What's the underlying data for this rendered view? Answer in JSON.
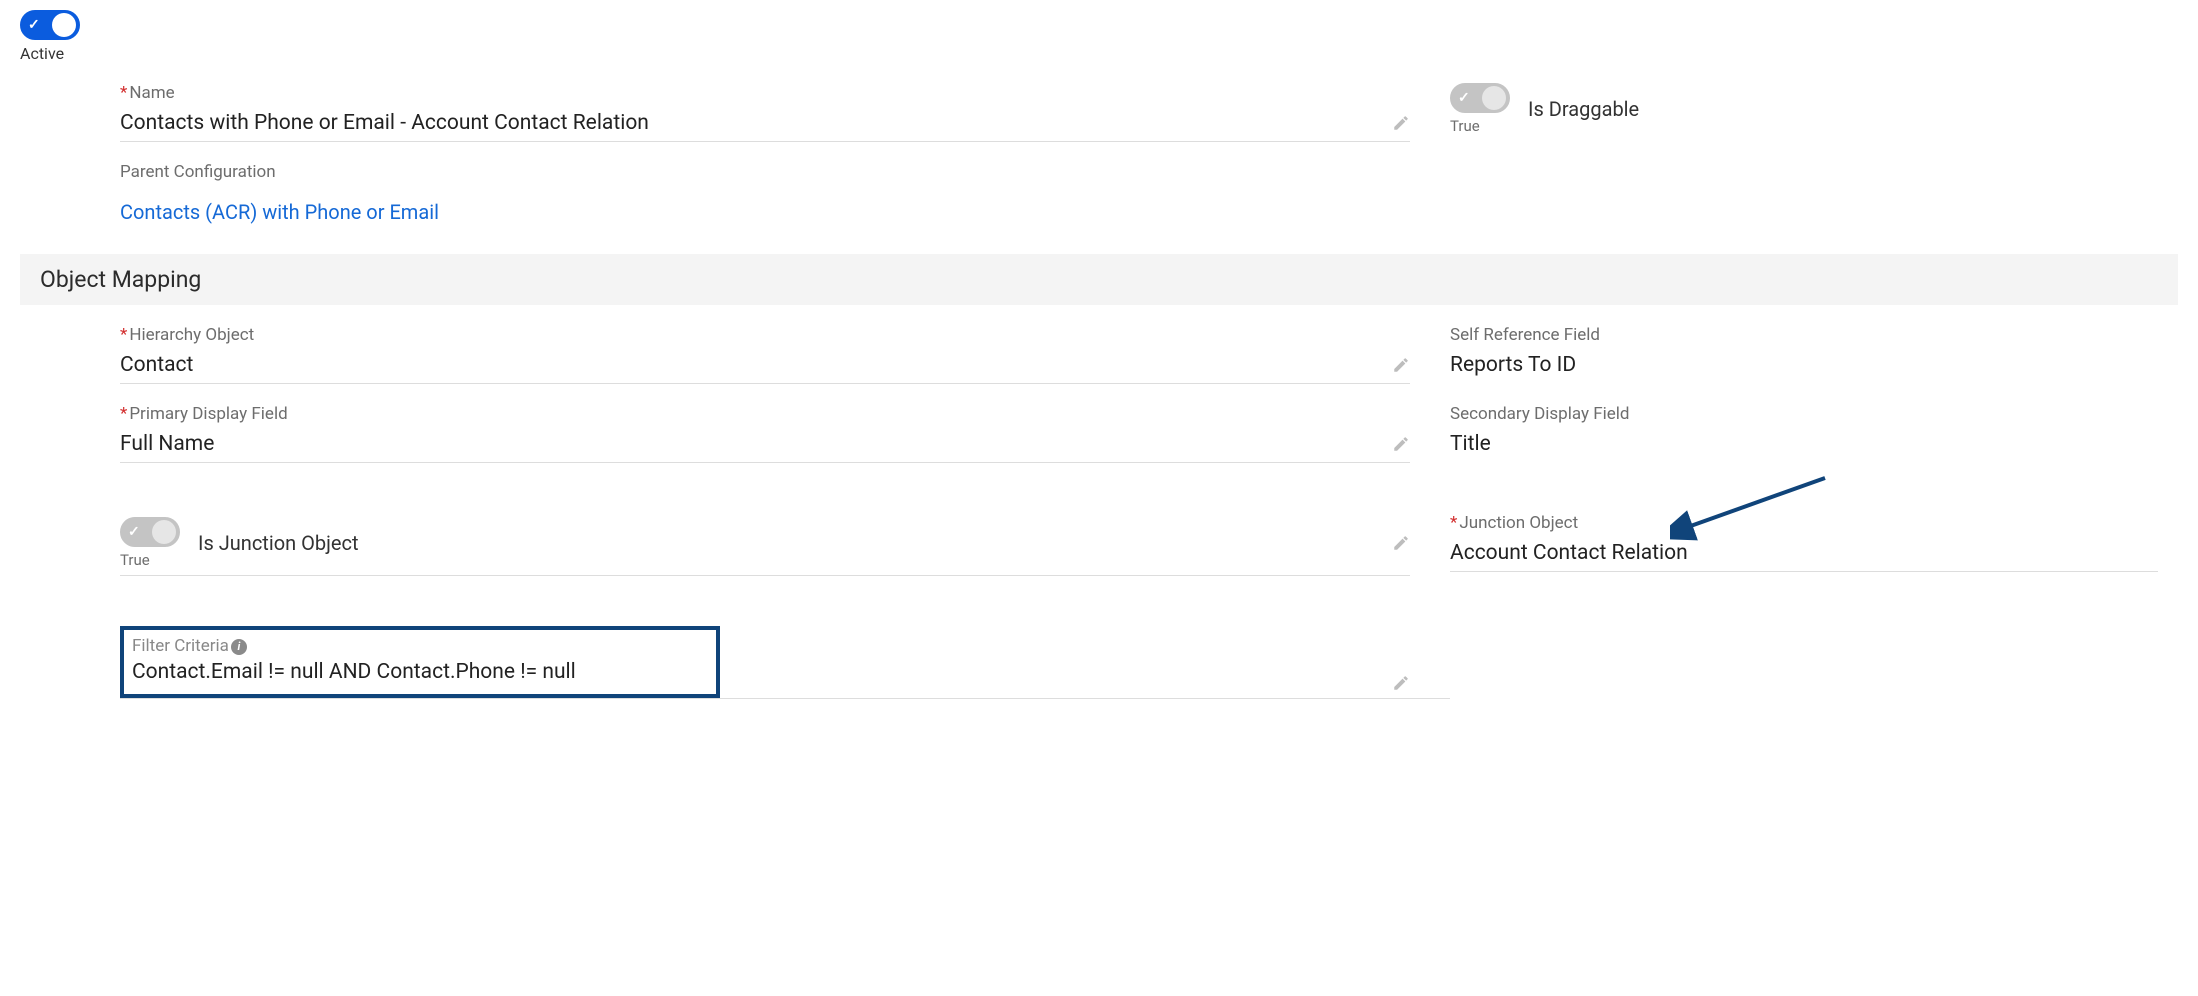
{
  "activeToggle": {
    "state": "on",
    "caption": "Active"
  },
  "nameField": {
    "label": "Name",
    "required": true,
    "value": "Contacts with Phone or Email - Account Contact Relation"
  },
  "isDraggable": {
    "label": "Is Draggable",
    "state": "on",
    "caption": "True"
  },
  "parentConfig": {
    "label": "Parent Configuration",
    "linkText": "Contacts (ACR) with Phone or Email"
  },
  "sections": {
    "objectMapping": "Object Mapping"
  },
  "hierarchyObject": {
    "label": "Hierarchy Object",
    "required": true,
    "value": "Contact"
  },
  "selfReferenceField": {
    "label": "Self Reference Field",
    "value": "Reports To ID"
  },
  "primaryDisplayField": {
    "label": "Primary Display Field",
    "required": true,
    "value": "Full Name"
  },
  "secondaryDisplayField": {
    "label": "Secondary Display Field",
    "value": "Title"
  },
  "isJunctionObject": {
    "label": "Is Junction Object",
    "state": "on",
    "caption": "True"
  },
  "junctionObject": {
    "label": "Junction Object",
    "required": true,
    "value": "Account Contact Relation"
  },
  "filterCriteria": {
    "label": "Filter Criteria",
    "value": "Contact.Email != null AND Contact.Phone != null"
  }
}
